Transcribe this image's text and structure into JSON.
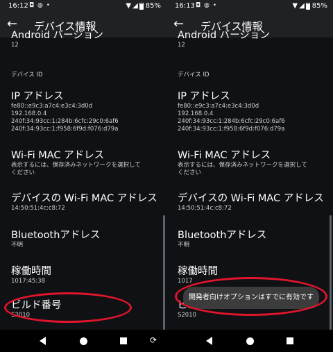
{
  "left": {
    "status": {
      "time": "16:12",
      "notif_icons": "◘ ◍ •",
      "battery": "85%"
    },
    "appbar_title": "デバイス情報",
    "items": [
      {
        "title": "Android バージョン",
        "sub": [
          "12"
        ]
      },
      {
        "title": "IP アドレス",
        "sub": [
          "fe80::e9c3:a7c4:e3c4:3d0d",
          "192.168.0.4",
          "240f:34:93cc:1:284b:6cfc:29c0:6af6",
          "240f:34:93cc:1:f958:6f9d:f076:d79a"
        ]
      },
      {
        "title": "Wi-Fi MAC アドレス",
        "sub": [
          "表示するには、保存済みネットワークを選択して",
          "ください"
        ]
      },
      {
        "title": "デバイスの Wi-Fi MAC アドレス",
        "sub": [
          "14:50:51:4c:c8:72"
        ]
      },
      {
        "title": "Bluetoothアドレス",
        "sub": [
          "不明"
        ]
      },
      {
        "title": "稼働時間",
        "sub": [
          "1017:45:38"
        ]
      },
      {
        "title": "ビルド番号",
        "sub": [
          "S2010"
        ]
      }
    ],
    "section_head": "デバイス ID"
  },
  "right": {
    "status": {
      "time": "16:13",
      "notif_icons": "◘ ◍ •",
      "battery": "85%"
    },
    "appbar_title": "デバイス情報",
    "items": [
      {
        "title": "Android バージョン",
        "sub": [
          "12"
        ]
      },
      {
        "title": "IP アドレス",
        "sub": [
          "fe80::e9c3:a7c4:e3c4:3d0d",
          "192.168.0.4",
          "240f:34:93cc:1:284b:6cfc:29c0:6af6",
          "240f:34:93cc:1:f958:6f9d:f076:d79a"
        ]
      },
      {
        "title": "Wi-Fi MAC アドレス",
        "sub": [
          "表示するには、保存済みネットワークを選択して",
          "ください"
        ]
      },
      {
        "title": "デバイスの Wi-Fi MAC アドレス",
        "sub": [
          "14:50:51:4c:c8:72"
        ]
      },
      {
        "title": "Bluetoothアドレス",
        "sub": [
          "不明"
        ]
      },
      {
        "title": "稼働時間",
        "sub": [
          "1017"
        ]
      },
      {
        "title": "ビルド番号",
        "sub": [
          "S2010"
        ]
      }
    ],
    "section_head": "デバイス ID",
    "toast": "開発者向けオプションはすでに有効です"
  },
  "icons": {
    "back": "←",
    "wifi": "▼",
    "signal": "◢",
    "rotate": "⟳"
  },
  "colors": {
    "annotation": "#e0152c",
    "appbar": "#202124",
    "background": "#101114"
  }
}
